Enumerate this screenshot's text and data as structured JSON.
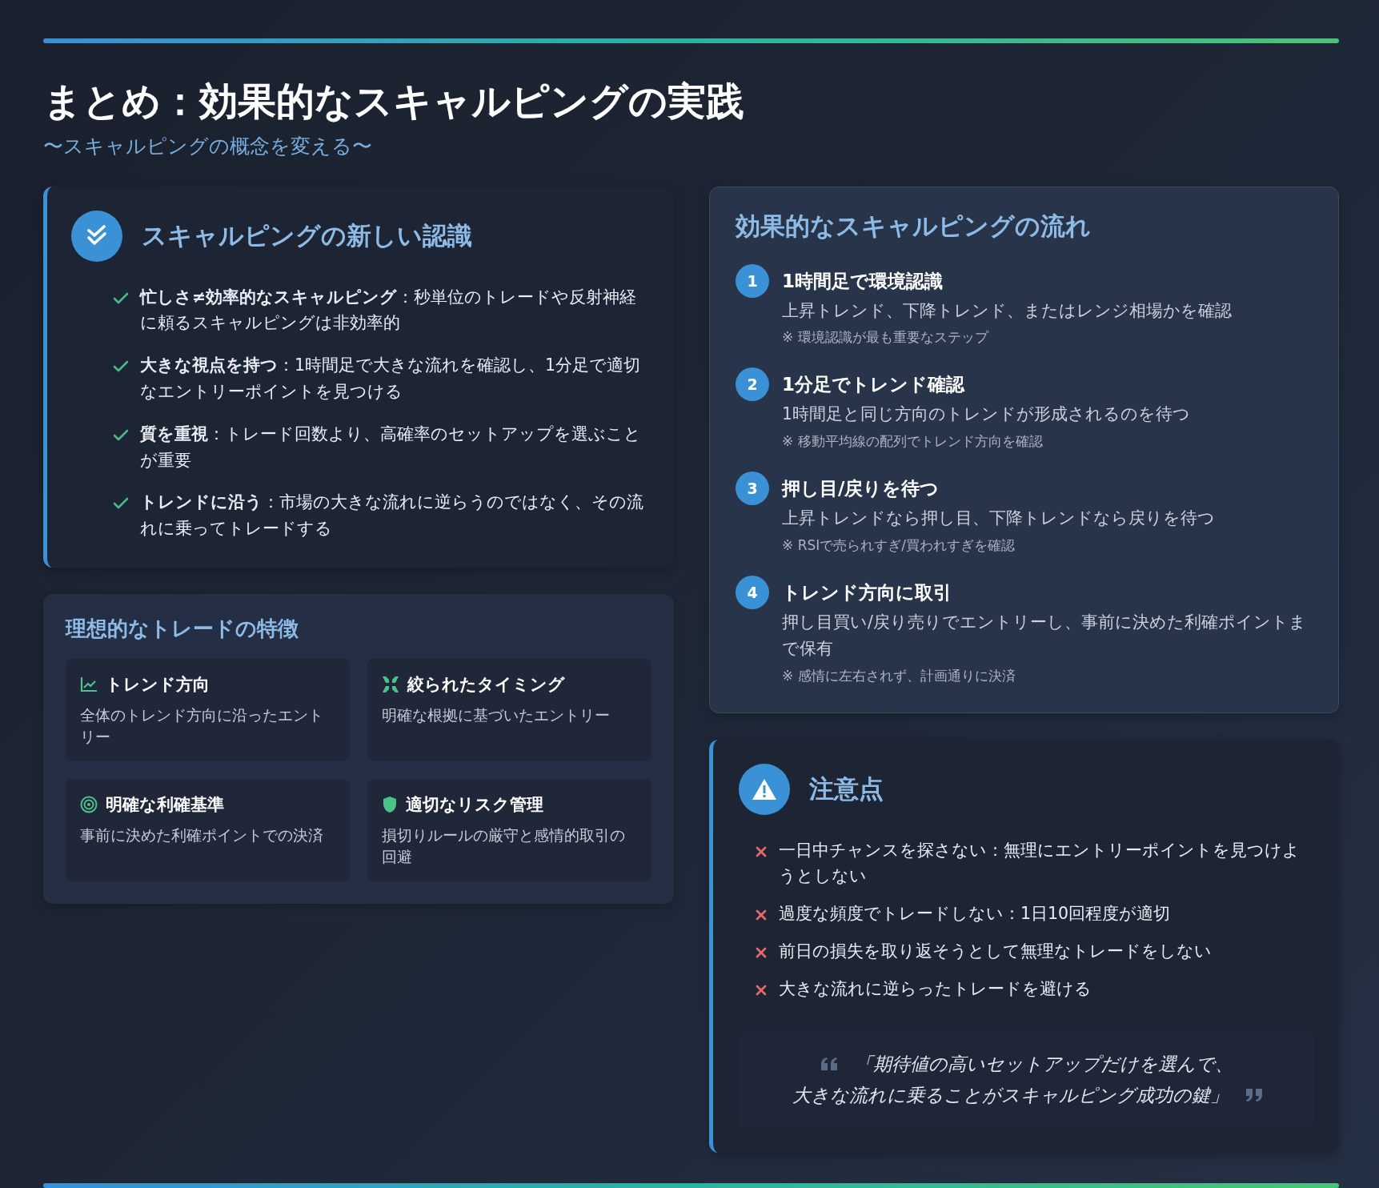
{
  "header": {
    "title": "まとめ：効果的なスキャルピングの実践",
    "subtitle": "〜スキャルピングの概念を変える〜"
  },
  "recognition": {
    "title": "スキャルピングの新しい認識",
    "items": [
      {
        "text": "**忙しさ≠効率的なスキャルピング**：秒単位のトレードや反射神経に頼るスキャルピングは非効率的"
      },
      {
        "text": "**大きな視点を持つ**：1時間足で大きな流れを確認し、1分足で適切なエントリーポイントを見つける"
      },
      {
        "text": "**質を重視**：トレード回数より、高確率のセットアップを選ぶことが重要"
      },
      {
        "text": "**トレンドに沿う**：市場の大きな流れに逆らうのではなく、その流れに乗ってトレードする"
      }
    ]
  },
  "features": {
    "title": "理想的なトレードの特徴",
    "items": [
      {
        "kind": "trend",
        "title": "トレンド方向",
        "description": "全体のトレンド方向に沿ったエントリー"
      },
      {
        "kind": "compress",
        "title": "絞られたタイミング",
        "description": "明確な根拠に基づいたエントリー"
      },
      {
        "kind": "target",
        "title": "明確な利確基準",
        "description": "事前に決めた利確ポイントでの決済"
      },
      {
        "kind": "shield",
        "title": "適切なリスク管理",
        "description": "損切りルールの厳守と感情的取引の回避"
      }
    ]
  },
  "flow": {
    "title": "効果的なスキャルピングの流れ",
    "steps": [
      {
        "number": "1",
        "title": "1時間足で環境認識",
        "description": "上昇トレンド、下降トレンド、またはレンジ相場かを確認",
        "note": "※ 環境認識が最も重要なステップ"
      },
      {
        "number": "2",
        "title": "1分足でトレンド確認",
        "description": "1時間足と同じ方向のトレンドが形成されるのを待つ",
        "note": "※ 移動平均線の配列でトレンド方向を確認"
      },
      {
        "number": "3",
        "title": "押し目/戻りを待つ",
        "description": "上昇トレンドなら押し目、下降トレンドなら戻りを待つ",
        "note": "※ RSIで売られすぎ/買われすぎを確認"
      },
      {
        "number": "4",
        "title": "トレンド方向に取引",
        "description": "押し目買い/戻り売りでエントリーし、事前に決めた利確ポイントまで保有",
        "note": "※ 感情に左右されず、計画通りに決済"
      }
    ]
  },
  "cautions": {
    "title": "注意点",
    "items": [
      {
        "text": "一日中チャンスを探さない：無理にエントリーポイントを見つけようとしない"
      },
      {
        "text": "過度な頻度でトレードしない：1日10回程度が適切"
      },
      {
        "text": "前日の損失を取り返そうとして無理なトレードをしない"
      },
      {
        "text": "大きな流れに逆らったトレードを避ける"
      }
    ],
    "quote": [
      "「期待値の高いセットアップだけを選んで、",
      "大きな流れに乗ることがスキャルピング成功の鍵」"
    ]
  }
}
